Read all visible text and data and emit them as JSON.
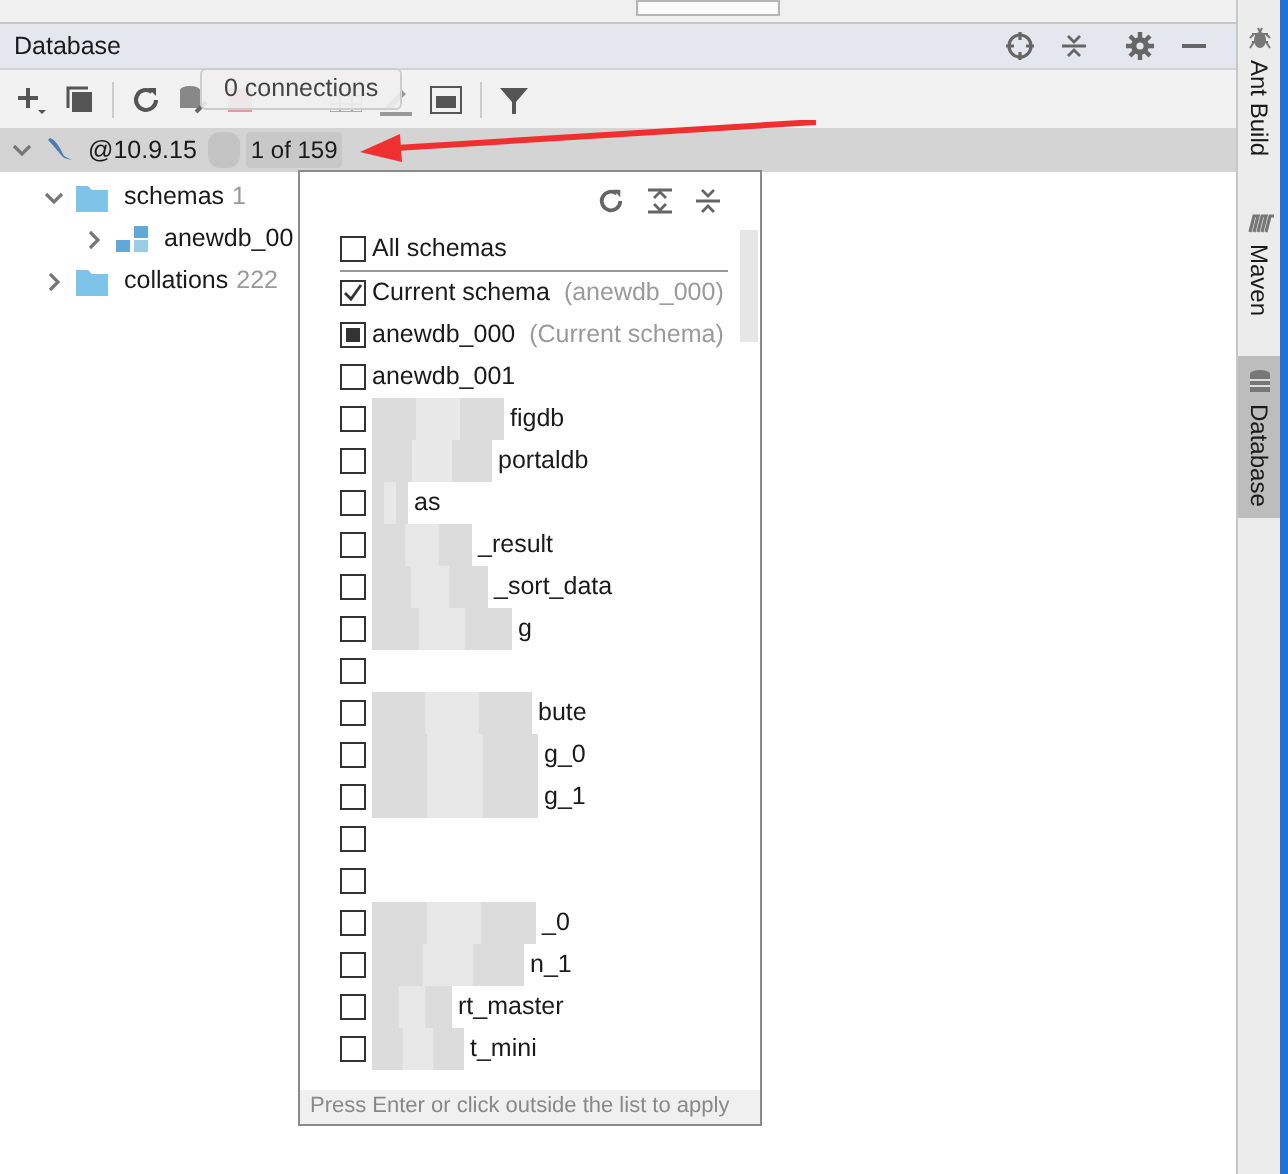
{
  "panel": {
    "title": "Database"
  },
  "tooltip": "0 connections",
  "connection": {
    "host": "@10.9.15",
    "expanded": true,
    "badge": "1 of 159"
  },
  "tree": [
    {
      "label": "schemas",
      "count": "1",
      "expanded": true,
      "children": [
        {
          "label": "anewdb_00",
          "expanded": false
        }
      ]
    },
    {
      "label": "collations",
      "count": "222",
      "expanded": false
    }
  ],
  "schema_popup": {
    "options": [
      {
        "label": "All schemas",
        "checked": false,
        "partial": false
      },
      {
        "label": "Current schema",
        "hint": "(anewdb_000)",
        "checked": true,
        "partial": false
      }
    ],
    "schemas": [
      {
        "label": "anewdb_000",
        "hint": "(Current schema)",
        "checked": false,
        "partial": true
      },
      {
        "label": "anewdb_001",
        "checked": false,
        "partial": false
      },
      {
        "label": "figdb",
        "checked": false,
        "partial": false
      },
      {
        "label": "portaldb",
        "checked": false,
        "partial": false
      },
      {
        "label": "as",
        "checked": false,
        "partial": false
      },
      {
        "label": "_result",
        "checked": false,
        "partial": false
      },
      {
        "label": "_sort_data",
        "checked": false,
        "partial": false
      },
      {
        "label": "g",
        "checked": false,
        "partial": false
      },
      {
        "checked": false,
        "partial": false
      },
      {
        "label": "bute",
        "checked": false,
        "partial": false
      },
      {
        "label": "g_0",
        "checked": false,
        "partial": false
      },
      {
        "label": "g_1",
        "checked": false,
        "partial": false
      },
      {
        "checked": false,
        "partial": false
      },
      {
        "checked": false,
        "partial": false
      },
      {
        "label": "_0",
        "checked": false,
        "partial": false
      },
      {
        "label": "n_1",
        "checked": false,
        "partial": false
      },
      {
        "label": "rt_master",
        "checked": false,
        "partial": false
      },
      {
        "label": "t_mini",
        "checked": false,
        "partial": false
      }
    ],
    "footer": "Press Enter or click outside the list to apply"
  },
  "side_tabs": [
    {
      "label": "Ant Build",
      "selected": false
    },
    {
      "label": "Maven",
      "selected": false
    },
    {
      "label": "Database",
      "selected": true
    }
  ]
}
